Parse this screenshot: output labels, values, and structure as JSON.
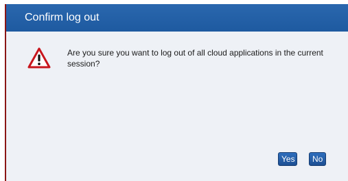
{
  "dialog": {
    "title": "Confirm log out",
    "message": "Are you sure you want to log out of all cloud applications in the current session?",
    "icon": "warning-icon",
    "buttons": {
      "yes": "Yes",
      "no": "No"
    }
  },
  "colors": {
    "titlebar": "#1f5ca3",
    "body": "#eef1f6",
    "button": "#255fa8",
    "warning_red": "#c8161d"
  }
}
